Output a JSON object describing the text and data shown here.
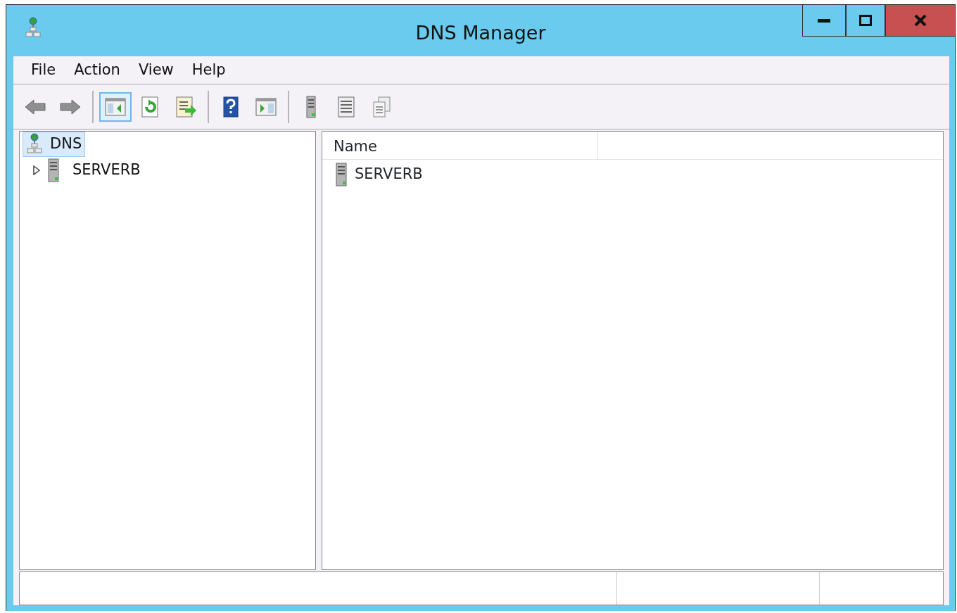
{
  "window": {
    "title": "DNS Manager"
  },
  "menu": [
    "File",
    "Action",
    "View",
    "Help"
  ],
  "toolbar": [
    {
      "kind": "button",
      "pressed": false
    },
    {
      "kind": "button",
      "pressed": false
    },
    {
      "kind": "separator"
    },
    {
      "kind": "button",
      "pressed": true
    },
    {
      "kind": "button",
      "pressed": false
    },
    {
      "kind": "button",
      "pressed": false
    },
    {
      "kind": "separator"
    },
    {
      "kind": "button",
      "pressed": false
    },
    {
      "kind": "button",
      "pressed": false
    },
    {
      "kind": "separator"
    },
    {
      "kind": "button",
      "pressed": false
    },
    {
      "kind": "button",
      "pressed": false
    },
    {
      "kind": "button",
      "pressed": false
    }
  ],
  "tree": [
    {
      "label": "DNS",
      "kind": "dns",
      "selected": true,
      "children": [
        {
          "label": "SERVERB",
          "kind": "server",
          "selected": false,
          "expanded": false
        }
      ]
    }
  ],
  "list": {
    "columns": [
      "Name"
    ],
    "rows": [
      {
        "name": "SERVERB",
        "kind": "server"
      }
    ]
  }
}
